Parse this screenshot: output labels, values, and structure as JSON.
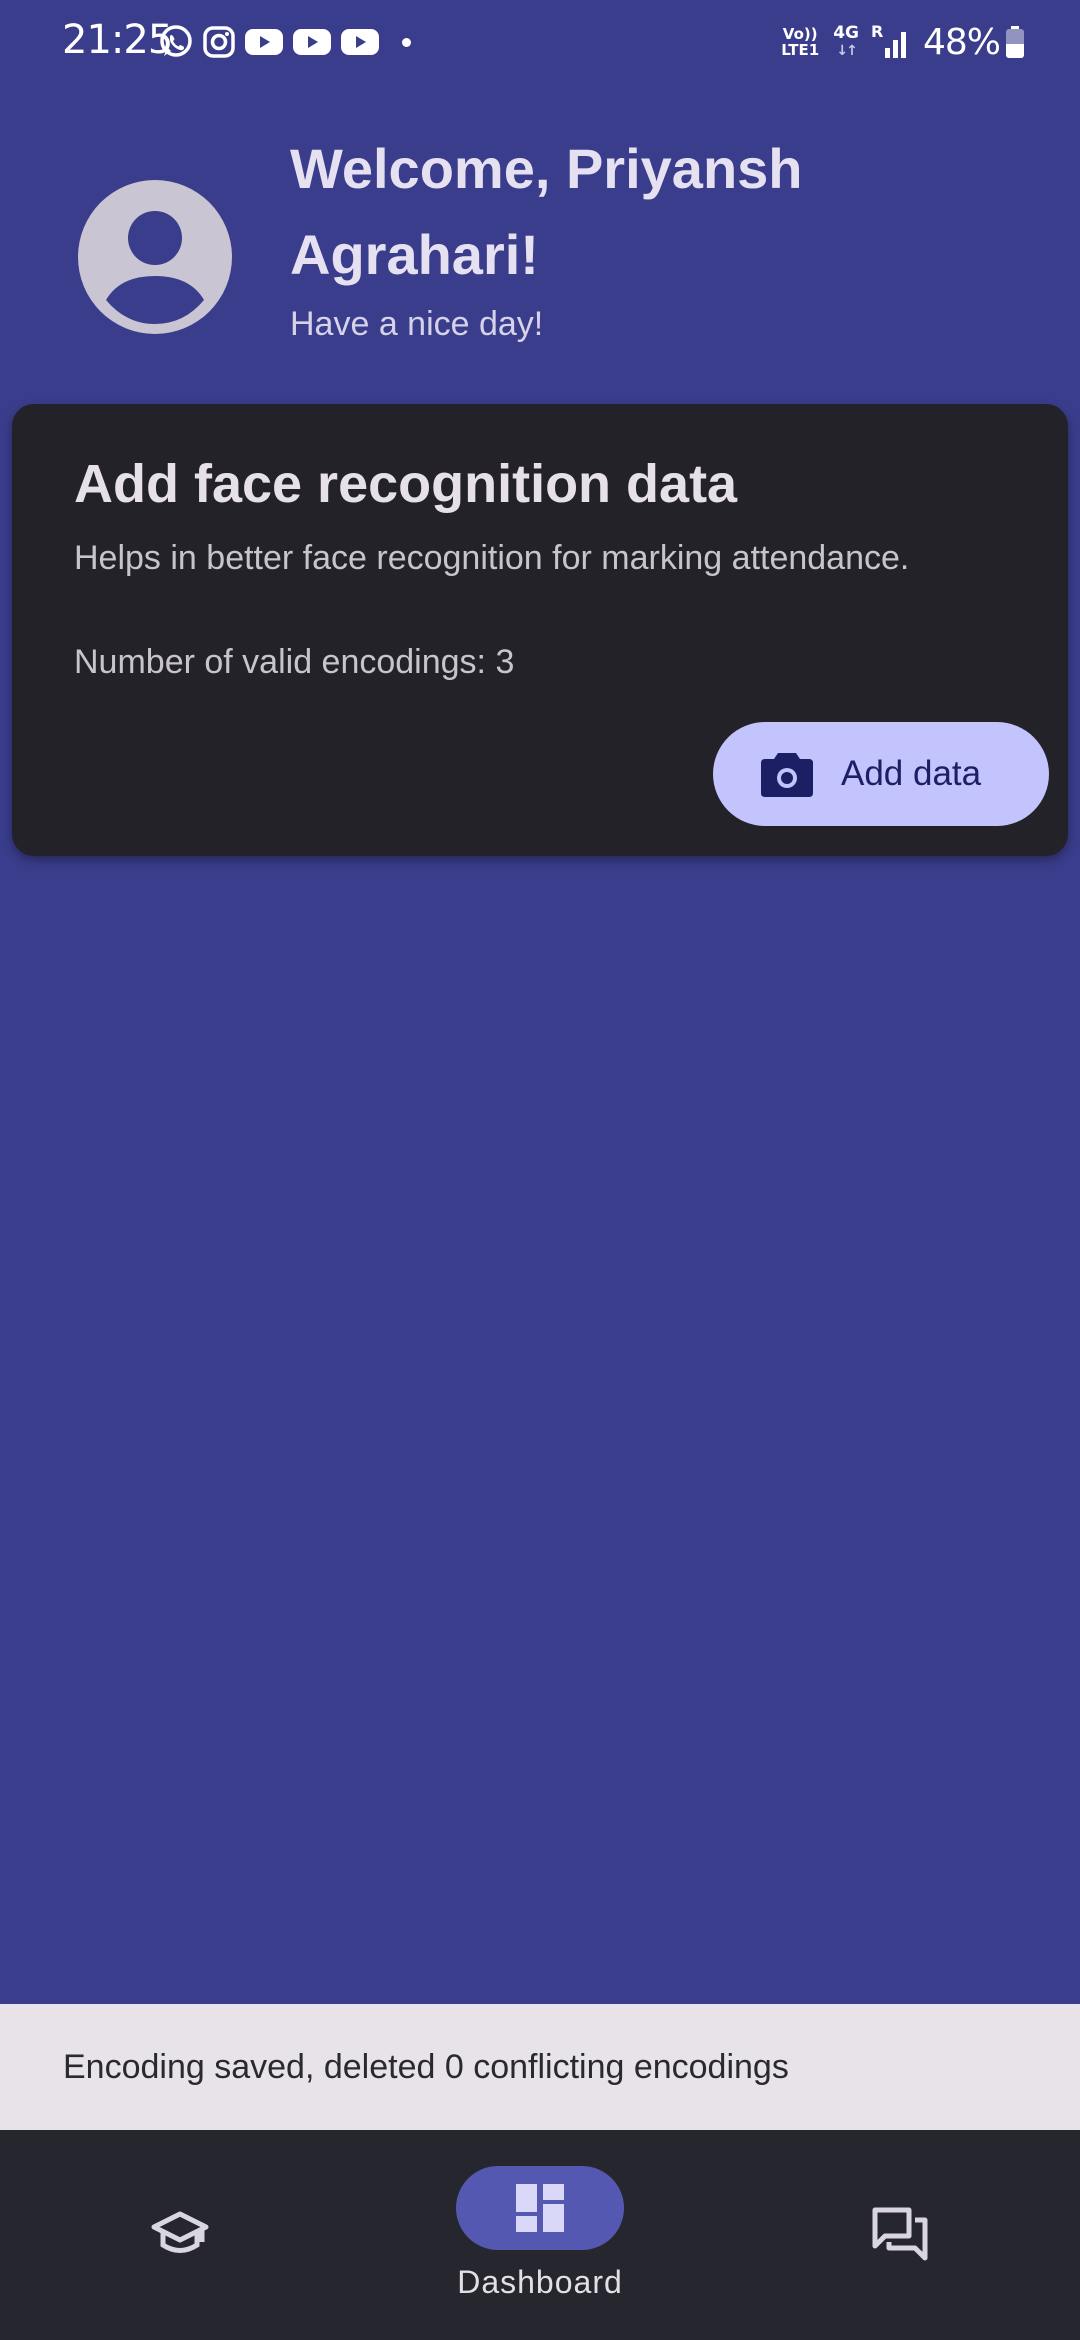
{
  "status_bar": {
    "time": "21:25",
    "notification_icons": [
      "whatsapp-icon",
      "instagram-icon",
      "youtube-icon",
      "youtube-icon",
      "youtube-icon",
      "dot-icon"
    ],
    "volte_top": "Vo))",
    "volte_bottom": "LTE1",
    "network": "4G",
    "network_arrows": "↓↑",
    "roaming": "R",
    "battery": "48%",
    "battery_level": 0.48
  },
  "header": {
    "title": "Welcome, Priyansh Agrahari!",
    "subtitle": "Have a nice day!"
  },
  "card": {
    "title": "Add face recognition data",
    "description": "Helps in better face recognition for marking attendance.",
    "count_text": "Number of valid encodings: 3",
    "button_label": "Add data",
    "button_icon": "camera-icon"
  },
  "snackbar": {
    "message": "Encoding saved, deleted 0 conflicting encodings"
  },
  "bottom_nav": {
    "items": [
      {
        "icon": "school-icon",
        "label": ""
      },
      {
        "icon": "dashboard-icon",
        "label": "Dashboard",
        "active": true
      },
      {
        "icon": "forum-icon",
        "label": ""
      }
    ]
  },
  "colors": {
    "background": "#3a3d8c",
    "card": "#232228",
    "button": "#c3c3fe",
    "button_text": "#1c1f63",
    "snackbar": "#e7e3e9",
    "nav_bar": "#26262e",
    "nav_active_pill": "#5558b1"
  }
}
